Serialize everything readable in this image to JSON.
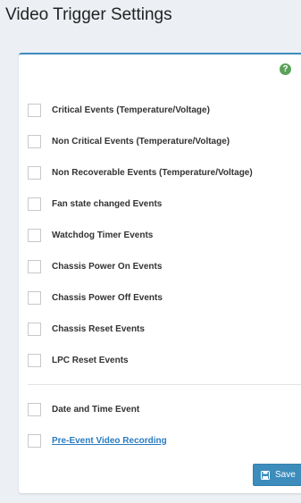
{
  "page": {
    "title": "Video Trigger Settings"
  },
  "help": {
    "glyph": "?"
  },
  "triggers": [
    {
      "label": "Critical Events (Temperature/Voltage)",
      "checked": false
    },
    {
      "label": "Non Critical Events (Temperature/Voltage)",
      "checked": false
    },
    {
      "label": "Non Recoverable Events (Temperature/Voltage)",
      "checked": false
    },
    {
      "label": "Fan state changed Events",
      "checked": false
    },
    {
      "label": "Watchdog Timer Events",
      "checked": false
    },
    {
      "label": "Chassis Power On Events",
      "checked": false
    },
    {
      "label": "Chassis Power Off Events",
      "checked": false
    },
    {
      "label": "Chassis Reset Events",
      "checked": false
    },
    {
      "label": "LPC Reset Events",
      "checked": false
    }
  ],
  "extra": [
    {
      "label": "Date and Time Event",
      "checked": false
    },
    {
      "label": "Pre-Event Video Recording",
      "checked": false
    }
  ],
  "actions": {
    "save_label": "Save"
  },
  "colors": {
    "accent": "#3c8dbc",
    "link": "#2a7cc0",
    "help": "#5aa25a"
  }
}
